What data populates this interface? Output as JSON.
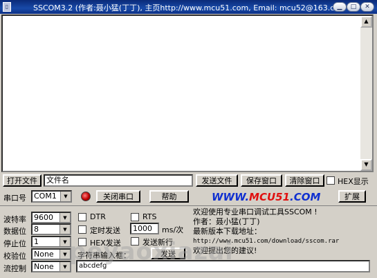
{
  "window": {
    "title": "SSCOM3.2 (作者:聂小猛(丁丁), 主页http://www.mcu51.com,  Email: mcu52@163.c...",
    "app_icon": "document-icon"
  },
  "toolbar_row1": {
    "open_file": "打开文件",
    "filename": "文件名",
    "send_file": "发送文件",
    "save_window": "保存窗口",
    "clear_window": "清除窗口",
    "hex_display": "HEX显示"
  },
  "toolbar_row2": {
    "port_label": "串口号",
    "port_value": "COM1",
    "close_port": "关闭串口",
    "help": "帮助",
    "expand": "扩展",
    "logo_pre": "WWW.",
    "logo_mid": "MCU51",
    "logo_post": ".COM"
  },
  "settings": {
    "baud_label": "波特率",
    "baud_value": "9600",
    "data_label": "数据位",
    "data_value": "8",
    "stop_label": "停止位",
    "stop_value": "1",
    "parity_label": "校验位",
    "parity_value": "None",
    "flow_label": "流控制",
    "flow_value": "None",
    "dtr": "DTR",
    "rts": "RTS",
    "timed_send": "定时发送",
    "interval_value": "1000",
    "interval_unit": "ms/次",
    "hex_send": "HEX发送",
    "send_newline": "发送新行",
    "input_label": "字符串输入框：",
    "send_button": "发送",
    "input_value": "abcdefg"
  },
  "info": {
    "line1": "欢迎使用专业串口调试工具SSCOM !",
    "line2": "作者：聂小猛(丁丁)",
    "line3": "最新版本下载地址：",
    "line4": "http://www.mcu51.com/download/sscom.rar",
    "line5": "欢迎提出您的建议!"
  },
  "watermark": "peyaoxiazai"
}
